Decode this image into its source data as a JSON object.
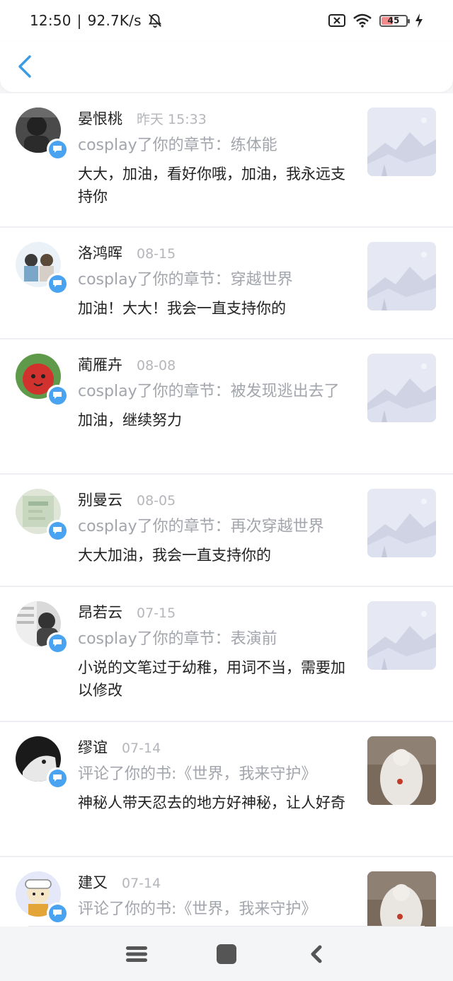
{
  "status_bar": {
    "time": "12:50",
    "separator": "|",
    "speed": "92.7K/s",
    "battery_level": "45"
  },
  "header": {
    "back_icon": "chevron-left-icon"
  },
  "colors": {
    "accent": "#3b9be3",
    "badge": "#4aa3f0",
    "battery_fill": "#f28b8b"
  },
  "items": [
    {
      "name": "晏恨桃",
      "time": "昨天 15:33",
      "action": "cosplay了你的章节：练体能",
      "comment": "大大，加油，看好你哦，加油，我永远支持你",
      "thumb": "placeholder-image"
    },
    {
      "name": "洛鸿晖",
      "time": "08-15",
      "action": "cosplay了你的章节：穿越世界",
      "comment": "加油！大大！我会一直支持你的",
      "thumb": "placeholder-image"
    },
    {
      "name": "蔺雁卉",
      "time": "08-08",
      "action": "cosplay了你的章节：被发现逃出去了",
      "comment": "加油，继续努力",
      "thumb": "placeholder-image"
    },
    {
      "name": "别曼云",
      "time": "08-05",
      "action": "cosplay了你的章节：再次穿越世界",
      "comment": "大大加油，我会一直支持你的",
      "thumb": "placeholder-image"
    },
    {
      "name": "昂若云",
      "time": "07-15",
      "action": "cosplay了你的章节：表演前",
      "comment": "小说的文笔过于幼稚，用词不当，需要加以修改",
      "thumb": "placeholder-image"
    },
    {
      "name": "缪谊",
      "time": "07-14",
      "action": "评论了你的书:《世界，我来守护》",
      "comment": "神秘人带天忍去的地方好神秘，让人好奇",
      "thumb": "book-cover"
    },
    {
      "name": "建又",
      "time": "07-14",
      "action": "评论了你的书:《世界，我来守护》",
      "comment": "",
      "thumb": "book-cover"
    }
  ],
  "nav": {
    "menu_icon": "menu-icon",
    "home_icon": "home-square-icon",
    "back_icon": "back-triangle-icon"
  }
}
